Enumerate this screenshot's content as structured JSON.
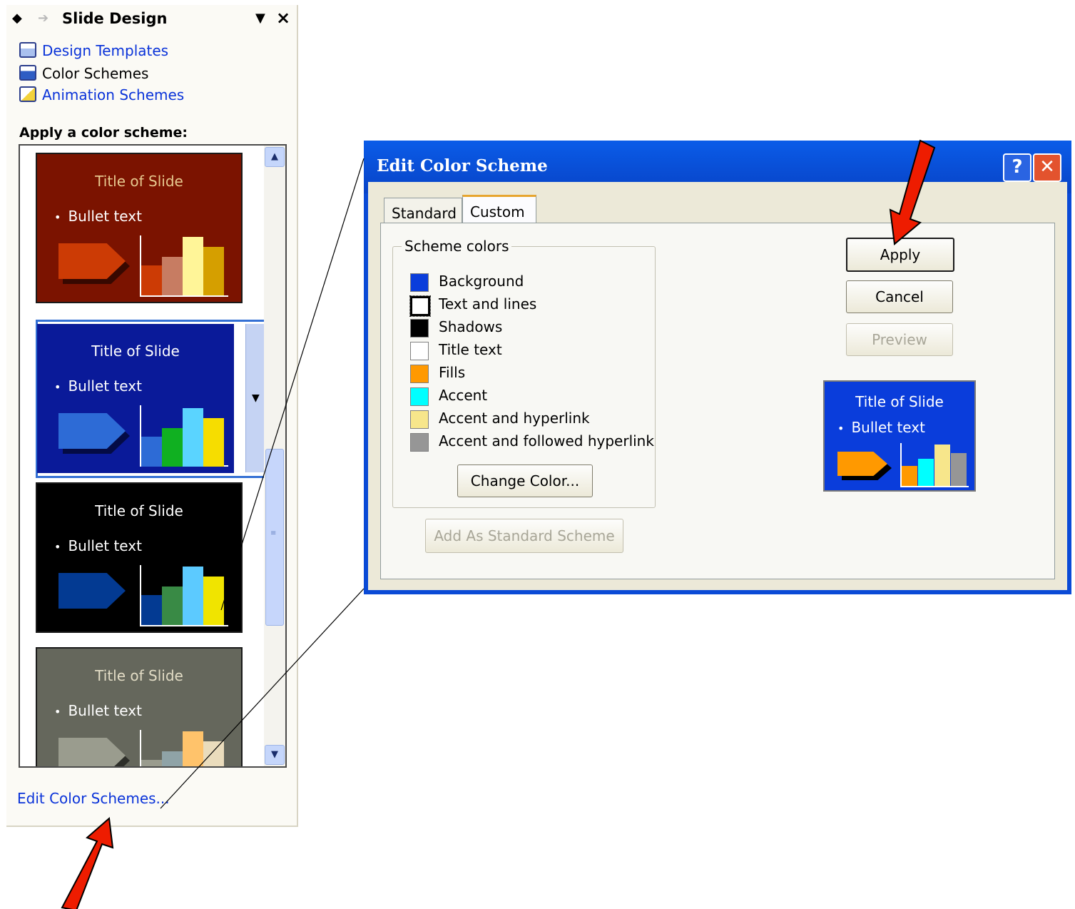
{
  "task_pane": {
    "title": "Slide Design",
    "links": [
      {
        "label": "Design Templates",
        "icon": "design-templates-icon"
      },
      {
        "label": "Color Schemes",
        "icon": "color-schemes-icon"
      },
      {
        "label": "Animation Schemes",
        "icon": "animation-schemes-icon"
      }
    ],
    "section_label": "Apply a color scheme:",
    "thumbnails": [
      {
        "title": "Title of Slide",
        "bullet": "Bullet text",
        "bg": "#7b1300",
        "title_color": "#e7c98f",
        "shape": "#cc3b05",
        "bars": [
          "#cc3b05",
          "#c77c62",
          "#fff598",
          "#d59f00"
        ]
      },
      {
        "title": "Title of Slide",
        "bullet": "Bullet text",
        "bg": "#0a1a99",
        "title_color": "#ffffff",
        "shape": "#2d6bd6",
        "bars": [
          "#2d6bd6",
          "#10b021",
          "#5ad4ff",
          "#f6dd00"
        ]
      },
      {
        "title": "Title of Slide",
        "bullet": "Bullet text",
        "bg": "#000000",
        "title_color": "#ffffff",
        "shape": "#033a92",
        "bars": [
          "#033a92",
          "#398a45",
          "#5ccaff",
          "#f0e400"
        ]
      },
      {
        "title": "Title of Slide",
        "bullet": "Bullet text",
        "bg": "#65675c",
        "title_color": "#e2dcc5",
        "shape": "#9a9c8e",
        "bars": [
          "#9a9c8e",
          "#8fa3a7",
          "#ffc36b",
          "#eadcbc"
        ]
      }
    ],
    "edit_link": "Edit Color Schemes..."
  },
  "dialog": {
    "title": "Edit Color Scheme",
    "help_label": "?",
    "close_label": "✕",
    "tabs": [
      "Standard",
      "Custom"
    ],
    "active_tab": "Custom",
    "group_caption": "Scheme colors",
    "scheme_colors": [
      {
        "label": "Background",
        "color": "#0a3ddb"
      },
      {
        "label": "Text and lines",
        "color": "#ffffff"
      },
      {
        "label": "Shadows",
        "color": "#000000"
      },
      {
        "label": "Title text",
        "color": "#ffffff"
      },
      {
        "label": "Fills",
        "color": "#ff9900"
      },
      {
        "label": "Accent",
        "color": "#00ffff"
      },
      {
        "label": "Accent and hyperlink",
        "color": "#f7e68b"
      },
      {
        "label": "Accent and followed hyperlink",
        "color": "#969696"
      }
    ],
    "change_color_label": "Change Color...",
    "add_standard_label": "Add As Standard Scheme",
    "apply_label": "Apply",
    "cancel_label": "Cancel",
    "preview_label": "Preview",
    "preview": {
      "title": "Title of Slide",
      "bullet": "Bullet text",
      "shape": "#ff9900",
      "bars": [
        "#ff9900",
        "#00ffff",
        "#f7e68b",
        "#969696"
      ]
    }
  },
  "annotation_colors": {
    "arrow": "#ee1c00"
  }
}
